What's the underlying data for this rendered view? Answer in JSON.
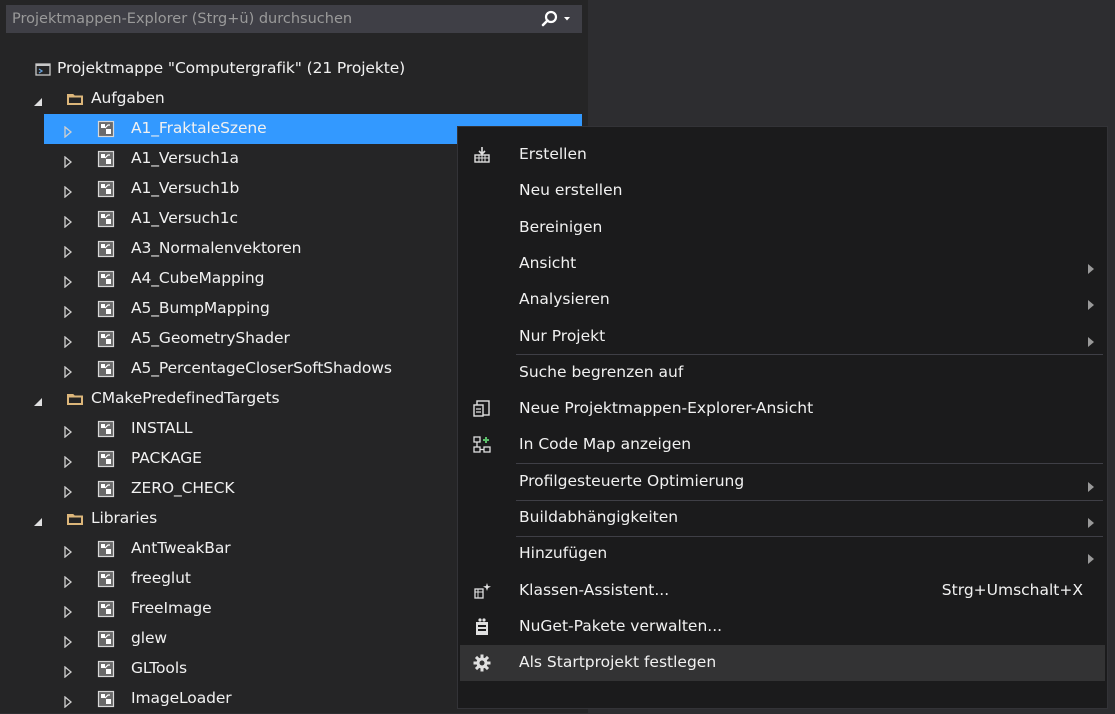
{
  "search": {
    "placeholder": "Projektmappen-Explorer (Strg+ü) durchsuchen"
  },
  "tree": {
    "solution": "Projektmappe \"Computergrafik\" (21 Projekte)",
    "groups": [
      {
        "label": "Aufgaben",
        "expanded": true,
        "items": [
          "A1_FraktaleSzene",
          "A1_Versuch1a",
          "A1_Versuch1b",
          "A1_Versuch1c",
          "A3_Normalenvektoren",
          "A4_CubeMapping",
          "A5_BumpMapping",
          "A5_GeometryShader",
          "A5_PercentageCloserSoftShadows"
        ]
      },
      {
        "label": "CMakePredefinedTargets",
        "expanded": true,
        "items": [
          "INSTALL",
          "PACKAGE",
          "ZERO_CHECK"
        ]
      },
      {
        "label": "Libraries",
        "expanded": true,
        "items": [
          "AntTweakBar",
          "freeglut",
          "FreeImage",
          "glew",
          "GLTools",
          "ImageLoader"
        ]
      }
    ],
    "selected": "A1_FraktaleSzene"
  },
  "context_menu": {
    "items": [
      {
        "label": "Erstellen",
        "icon": "build-icon"
      },
      {
        "label": "Neu erstellen"
      },
      {
        "label": "Bereinigen"
      },
      {
        "label": "Ansicht",
        "submenu": true
      },
      {
        "label": "Analysieren",
        "submenu": true
      },
      {
        "label": "Nur Projekt",
        "submenu": true
      },
      {
        "label": "Suche begrenzen auf"
      },
      {
        "label": "Neue Projektmappen-Explorer-Ansicht",
        "icon": "new-explorer-view-icon"
      },
      {
        "label": "In Code Map anzeigen",
        "icon": "code-map-icon"
      },
      {
        "label": "Profilgesteuerte Optimierung",
        "submenu": true
      },
      {
        "label": "Buildabhängigkeiten",
        "submenu": true
      },
      {
        "label": "Hinzufügen",
        "submenu": true
      },
      {
        "label": "Klassen-Assistent...",
        "shortcut": "Strg+Umschalt+X",
        "icon": "class-wizard-icon"
      },
      {
        "label": "NuGet-Pakete verwalten...",
        "icon": "nuget-icon"
      },
      {
        "label": "Als Startprojekt festlegen",
        "icon": "gear-icon"
      }
    ]
  },
  "colors": {
    "selection": "#3399ff",
    "menu_bg": "#1b1b1c",
    "panel_bg": "#252526",
    "hover": "#333334"
  }
}
